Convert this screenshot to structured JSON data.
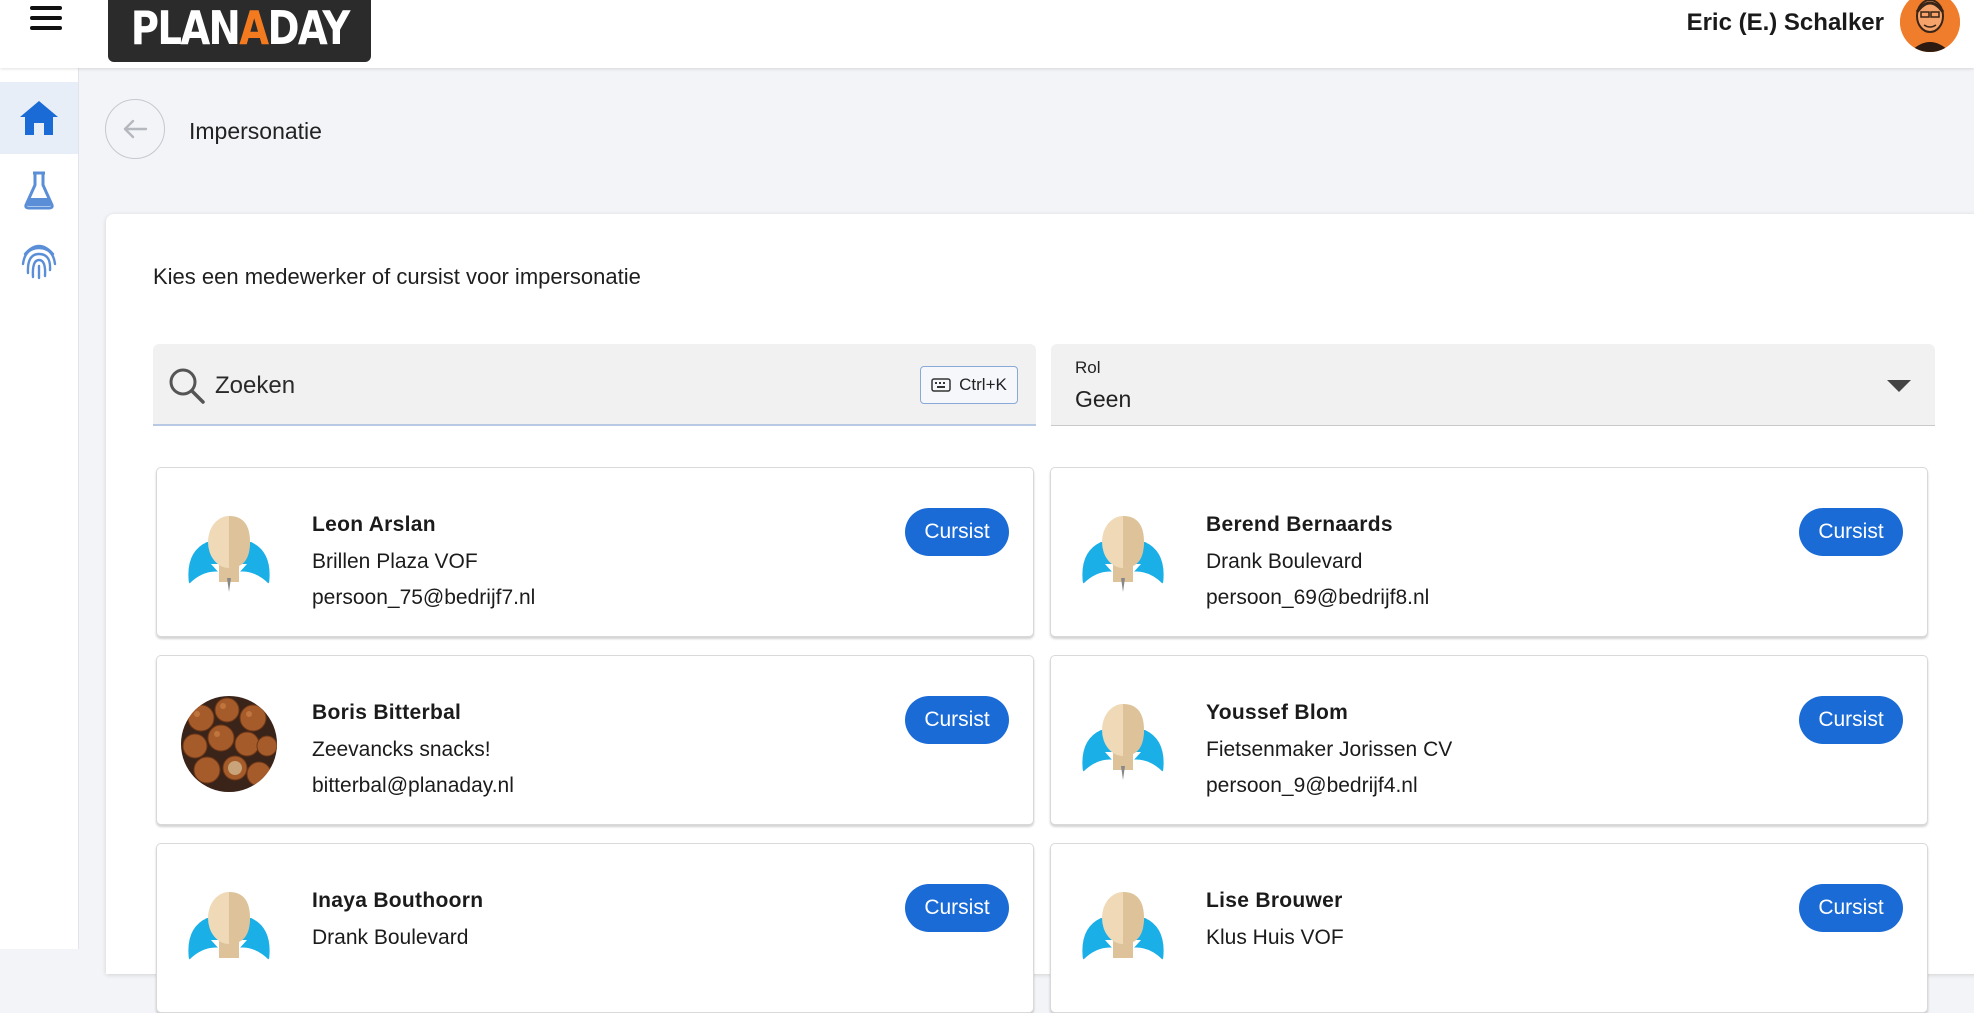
{
  "header": {
    "logo": {
      "part1": "PLAN",
      "accent": "A",
      "part2": "DAY"
    },
    "user_name": "Eric (E.) Schalker"
  },
  "sidebar": {
    "items": [
      {
        "icon": "home-icon",
        "active": true
      },
      {
        "icon": "flask-icon",
        "active": false
      },
      {
        "icon": "fingerprint-icon",
        "active": false
      }
    ]
  },
  "page": {
    "title": "Impersonatie",
    "subtitle": "Kies een medewerker of cursist voor impersonatie"
  },
  "search": {
    "placeholder": "Zoeken",
    "shortcut": "Ctrl+K"
  },
  "role_filter": {
    "label": "Rol",
    "value": "Geen"
  },
  "colors": {
    "accent": "#1a6bd6",
    "logo_bg": "#2b2b2b",
    "logo_accent": "#f47a20"
  },
  "people": [
    {
      "name": "Leon Arslan",
      "company": "Brillen Plaza VOF",
      "email": "persoon_75@bedrijf7.nl",
      "role": "Cursist",
      "avatar": "default-avatar"
    },
    {
      "name": "Berend Bernaards",
      "company": "Drank Boulevard",
      "email": "persoon_69@bedrijf8.nl",
      "role": "Cursist",
      "avatar": "default-avatar"
    },
    {
      "name": "Boris Bitterbal",
      "company": "Zeevancks snacks!",
      "email": "bitterbal@planaday.nl",
      "role": "Cursist",
      "avatar": "bitterballen-photo"
    },
    {
      "name": "Youssef Blom",
      "company": "Fietsenmaker Jorissen CV",
      "email": "persoon_9@bedrijf4.nl",
      "role": "Cursist",
      "avatar": "default-avatar"
    },
    {
      "name": "Inaya Bouthoorn",
      "company": "Drank Boulevard",
      "email": "",
      "role": "Cursist",
      "avatar": "default-avatar"
    },
    {
      "name": "Lise Brouwer",
      "company": "Klus Huis VOF",
      "email": "",
      "role": "Cursist",
      "avatar": "default-avatar"
    }
  ]
}
